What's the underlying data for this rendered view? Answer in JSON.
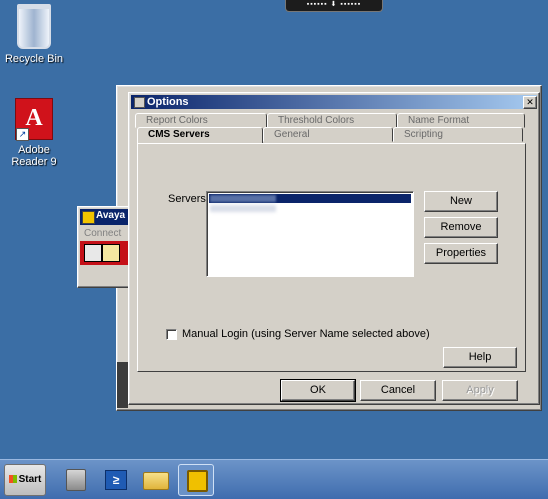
{
  "desktop": {
    "recycle_bin": "Recycle Bin",
    "adobe_reader": "Adobe Reader 9"
  },
  "top_bar": {
    "text": "▪▪▪▪▪▪ ⬇ ▪▪▪▪▪▪"
  },
  "avaya_window": {
    "title": "Avaya",
    "menu_connect": "Connect"
  },
  "dialog": {
    "title": "Options",
    "close_glyph": "✕",
    "tabs_back": [
      "Report Colors",
      "Threshold Colors",
      "Name Format"
    ],
    "tabs_front": [
      "CMS Servers",
      "General",
      "Scripting"
    ],
    "servers_label": "Servers:",
    "buttons": {
      "new": "New",
      "remove": "Remove",
      "properties": "Properties",
      "help": "Help"
    },
    "manual_login_label": "Manual Login (using Server Name selected above)",
    "footer": {
      "ok": "OK",
      "cancel": "Cancel",
      "apply": "Apply"
    }
  },
  "taskbar": {
    "start_label": "Start"
  },
  "colors": {
    "desktop": "#3b6ea5",
    "dialog_face": "#d4d0c8",
    "titlebar": "#0a246a",
    "selection": "#0a246a"
  }
}
